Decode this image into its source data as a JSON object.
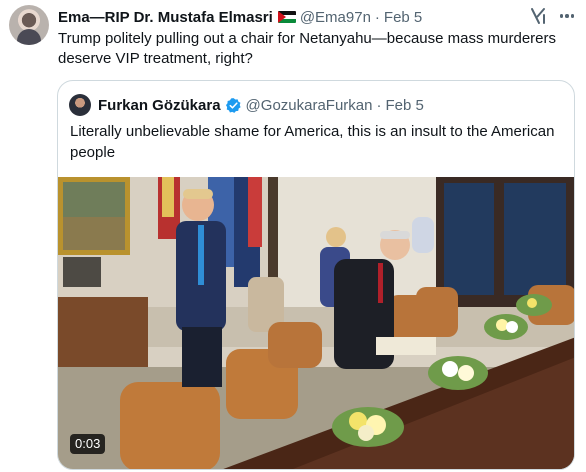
{
  "tweet": {
    "author_name": "Ema—RIP Dr. Mustafa Elmasri",
    "handle": "@Ema97n",
    "separator": "·",
    "date": "Feb 5",
    "text": "Trump politely pulling out a chair for Netanyahu—because mass murderers deserve VIP treatment, right?"
  },
  "icons": {
    "flag": "palestine-flag-emoji",
    "grok": "grok-icon",
    "more": "more-icon",
    "verified": "verified-badge-icon"
  },
  "quote": {
    "author_name": "Furkan Gözükara",
    "handle": "@GozukaraFurkan",
    "separator": "·",
    "date": "Feb 5",
    "text": "Literally unbelievable shame for America, this is an insult to the American people",
    "video": {
      "duration": "0:03"
    }
  },
  "colors": {
    "text_primary": "#0f1419",
    "text_secondary": "#536471",
    "border": "#cfd9de",
    "verified": "#1d9bf0"
  }
}
